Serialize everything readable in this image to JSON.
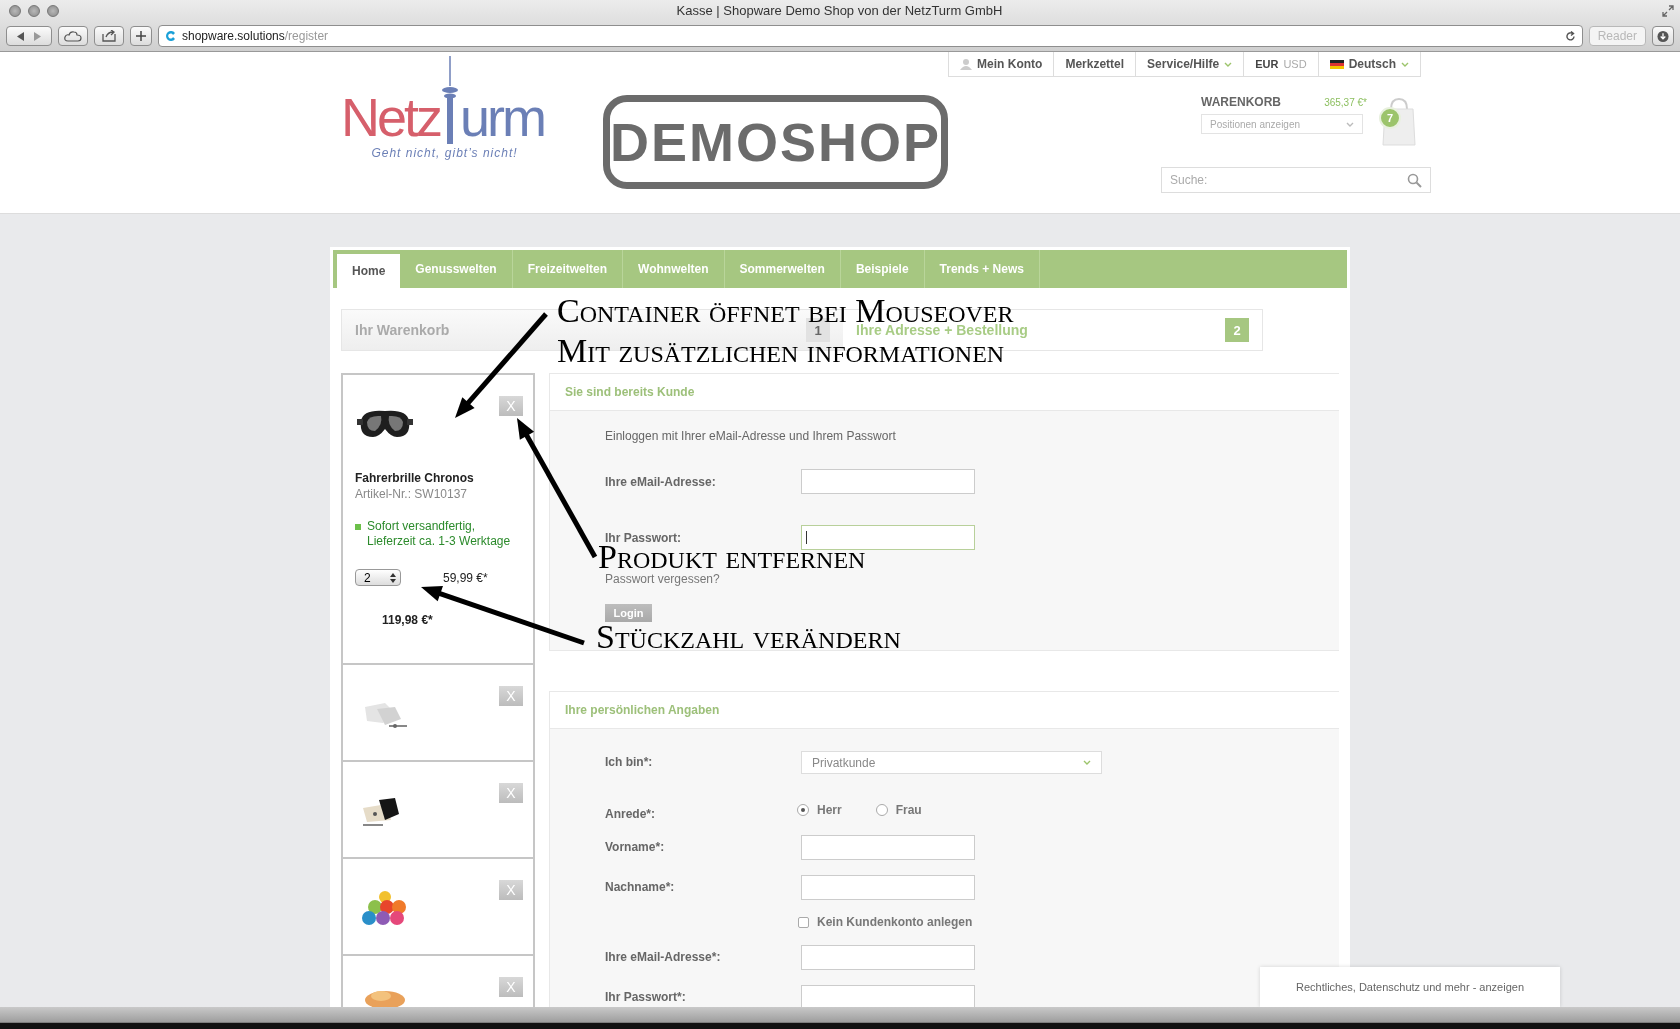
{
  "browser": {
    "title": "Kasse | Shopware Demo Shop von der NetzTurm GmbH",
    "url_host": "shopware.solutions",
    "url_path": "/register",
    "reader": "Reader"
  },
  "top_menu": [
    {
      "kind": "account",
      "label": "Mein Konto"
    },
    {
      "kind": "plain",
      "label": "Merkzettel"
    },
    {
      "kind": "dropdown",
      "label": "Service/Hilfe"
    },
    {
      "kind": "currency",
      "options": [
        {
          "label": "EUR",
          "selected": true
        },
        {
          "label": "USD",
          "selected": false
        }
      ]
    },
    {
      "kind": "language",
      "label": "Deutsch"
    }
  ],
  "logo": {
    "left": "Netz",
    "right": "urm",
    "tagline": "Geht nicht, gibt’s nicht!"
  },
  "banner": "DEMOSHOP",
  "cart": {
    "title": "WARENKORB",
    "total": "365,37 €*",
    "dropdown": "Positionen anzeigen",
    "count": "7"
  },
  "search": {
    "placeholder": "Suche:"
  },
  "nav": [
    {
      "label": "Home",
      "selected": true
    },
    {
      "label": "Genusswelten",
      "selected": false
    },
    {
      "label": "Freizeitwelten",
      "selected": false
    },
    {
      "label": "Wohnwelten",
      "selected": false
    },
    {
      "label": "Sommerwelten",
      "selected": false
    },
    {
      "label": "Beispiele",
      "selected": false
    },
    {
      "label": "Trends + News",
      "selected": false
    }
  ],
  "steps": [
    {
      "label": "Ihr Warenkorb",
      "number": "1",
      "selected": false
    },
    {
      "label": "Ihre Adresse + Bestellung",
      "number": "2",
      "selected": true
    }
  ],
  "cart_items": [
    {
      "expanded": true,
      "remove": "X",
      "name": "Fahrerbrille Chronos",
      "article": "Artikel-Nr.: SW10137",
      "availability": "Sofort versandfertig, Lieferzeit ca. 1-3 Werktage",
      "quantity": "2",
      "price": "59,99 €*",
      "total": "119,98 €*"
    },
    {
      "expanded": false,
      "remove": "X"
    },
    {
      "expanded": false,
      "remove": "X"
    },
    {
      "expanded": false,
      "remove": "X"
    },
    {
      "expanded": false,
      "remove": "X"
    }
  ],
  "login": {
    "title": "Sie sind bereits Kunde",
    "intro": "Einloggen mit Ihrer eMail-Adresse und Ihrem Passwort",
    "fields": [
      {
        "label": "Ihre eMail-Adresse:",
        "focused": false
      },
      {
        "label": "Ihr Passwort:",
        "focused": true
      }
    ],
    "forgot": "Passwort vergessen?",
    "button": "Login"
  },
  "personal": {
    "title": "Ihre persönlichen Angaben",
    "rows": [
      {
        "kind": "select",
        "label": "Ich bin*:",
        "value": "Privatkunde"
      },
      {
        "kind": "radio",
        "label": "Anrede*:",
        "options": [
          {
            "label": "Herr",
            "selected": true
          },
          {
            "label": "Frau",
            "selected": false
          }
        ]
      },
      {
        "kind": "text",
        "label": "Vorname*:"
      },
      {
        "kind": "text",
        "label": "Nachname*:"
      },
      {
        "kind": "checkbox",
        "label": "Kein Kundenkonto anlegen",
        "checked": false
      },
      {
        "kind": "text",
        "label": "Ihre eMail-Adresse*:"
      },
      {
        "kind": "text",
        "label": "Ihr Passwort*:"
      }
    ]
  },
  "annotations": [
    {
      "lines": [
        "Container öffnet bei Mouseover",
        "Mit zusätzlichen informationen"
      ]
    },
    {
      "lines": [
        "Produkt entfernen"
      ]
    },
    {
      "lines": [
        "Stückzahl verändern"
      ]
    }
  ],
  "footer_tab": "Rechtliches, Datenschutz und mehr - anzeigen"
}
